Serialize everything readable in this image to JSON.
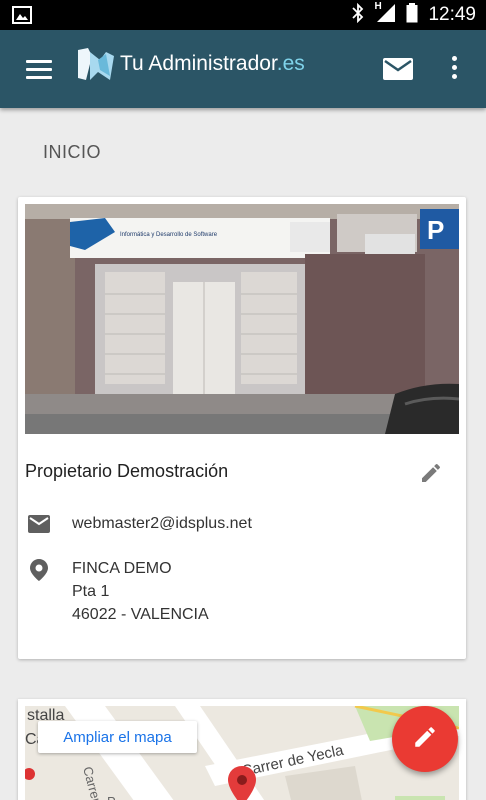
{
  "status_bar": {
    "time": "12:49",
    "network_label": "H",
    "icons": [
      "image-notification-icon",
      "bluetooth-icon",
      "signal-icon",
      "battery-icon"
    ]
  },
  "app_bar": {
    "title_main": "Tu Administrador",
    "title_suffix": ".es",
    "icons": [
      "menu-icon",
      "logo-icon",
      "mail-icon",
      "more-vert-icon"
    ]
  },
  "page": {
    "section_title": "INICIO"
  },
  "property_card": {
    "name": "Propietario Demostración",
    "email": "webmaster2@idsplus.net",
    "address_line1": "FINCA DEMO",
    "address_line2": "Pta 1",
    "address_line3": "46022 - VALENCIA",
    "photo_sign_text": "Informática y Desarrollo de Software",
    "icons": [
      "edit-icon",
      "email-icon",
      "location-pin-icon"
    ]
  },
  "map": {
    "enlarge_label": "Ampliar el mapa",
    "street_label": "Carrer de Yecla",
    "fragments": [
      "stalla",
      "Ca",
      "Carrer",
      "P"
    ]
  },
  "fab": {
    "icon": "pencil-icon",
    "color": "#ea3a33"
  },
  "colors": {
    "app_bar": "#2b5566",
    "title_suffix": "#7fd3ea",
    "background": "#ececec",
    "link": "#1a73e8"
  }
}
